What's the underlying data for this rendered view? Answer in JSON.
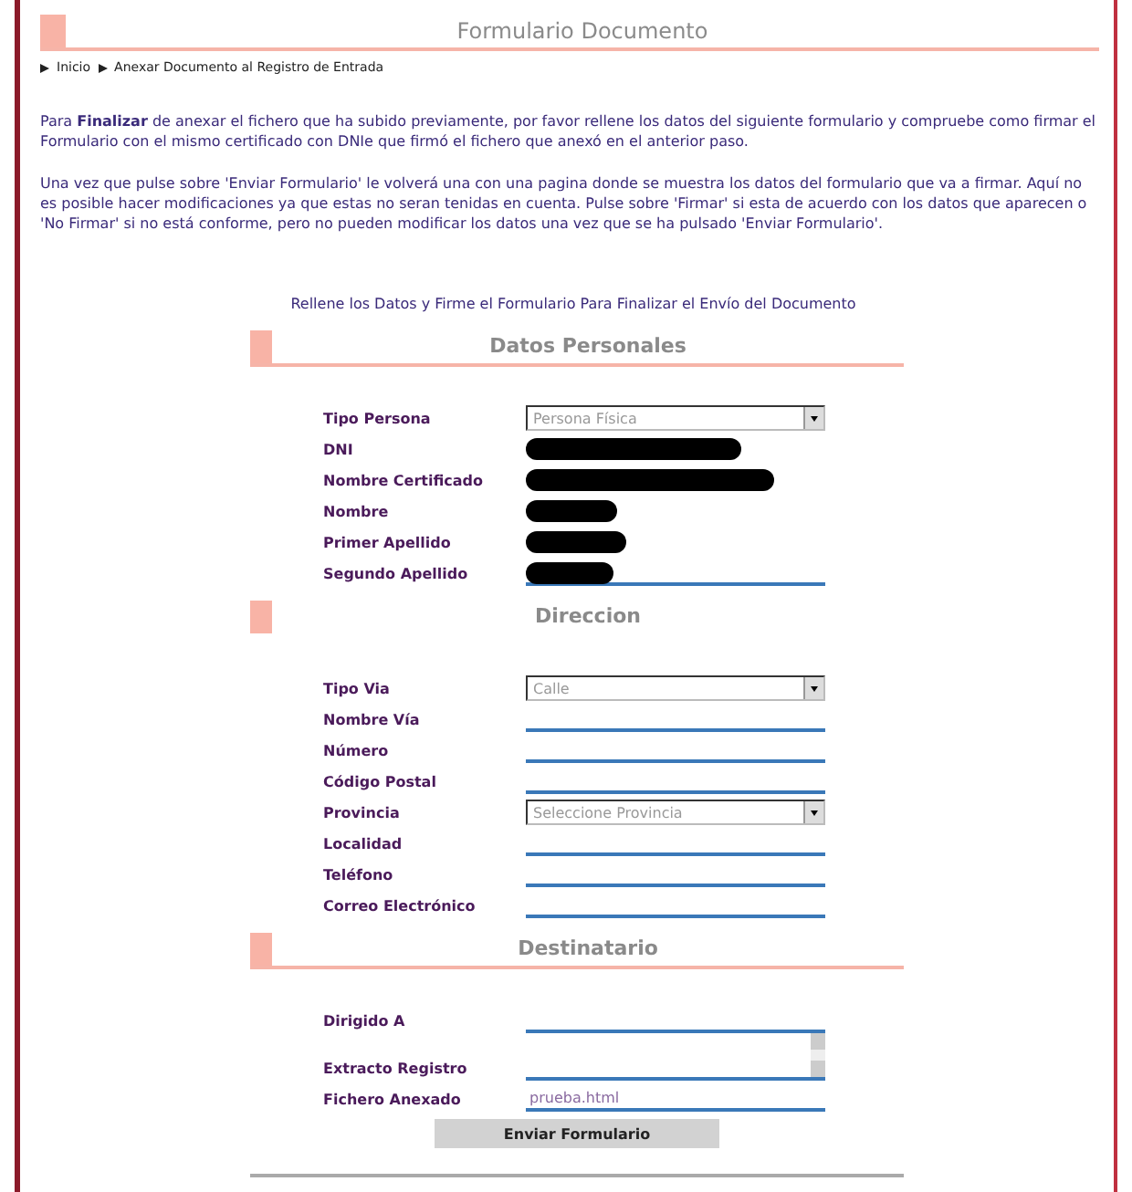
{
  "page": {
    "title": "Formulario Documento"
  },
  "breadcrumb": [
    "Inicio",
    "Anexar Documento al Registro de Entrada"
  ],
  "intro": [
    "Para **Finalizar** de anexar el fichero que ha subido previamente, por favor rellene los datos del siguiente formulario y compruebe como firmar el Formulario con el mismo certificado con DNIe que firmó el fichero que anexó en el anterior paso.",
    "Una vez que pulse sobre 'Enviar Formulario' le volverá una con una pagina donde se muestra los datos del formulario que va a firmar. Aquí no es posible hacer modificaciones ya que estas no seran tenidas en cuenta. Pulse sobre 'Firmar' si esta de acuerdo con los datos que aparecen o 'No Firmar' si no está conforme, pero no pueden modificar los datos una vez que se ha pulsado 'Enviar Formulario'."
  ],
  "instruction": "Rellene los Datos y Firme el Formulario Para Finalizar el Envío del Documento",
  "sections": [
    {
      "title": "Datos Personales",
      "underlined": true,
      "fields": [
        {
          "label": "Tipo Persona",
          "kind": "select",
          "value": "Persona Física"
        },
        {
          "label": "DNI",
          "kind": "redacted"
        },
        {
          "label": "Nombre Certificado",
          "kind": "redacted"
        },
        {
          "label": "Nombre",
          "kind": "redacted"
        },
        {
          "label": "Primer Apellido",
          "kind": "redacted"
        },
        {
          "label": "Segundo Apellido",
          "kind": "redacted"
        }
      ]
    },
    {
      "title": "Direccion",
      "underlined": false,
      "fields": [
        {
          "label": "Tipo Via",
          "kind": "select",
          "value": "Calle"
        },
        {
          "label": "Nombre Vía",
          "kind": "text"
        },
        {
          "label": "Número",
          "kind": "text"
        },
        {
          "label": "Código Postal",
          "kind": "text"
        },
        {
          "label": "Provincia",
          "kind": "select",
          "value": "Seleccione Provincia"
        },
        {
          "label": "Localidad",
          "kind": "text"
        },
        {
          "label": "Teléfono",
          "kind": "text"
        },
        {
          "label": "Correo Electrónico",
          "kind": "text"
        }
      ]
    },
    {
      "title": "Destinatario",
      "underlined": true,
      "fields": [
        {
          "label": "Dirigido A",
          "kind": "text"
        },
        {
          "label": "Extracto Registro",
          "kind": "textarea"
        },
        {
          "label": "Fichero Anexado",
          "kind": "text",
          "value": "prueba.html"
        }
      ]
    }
  ],
  "submit": "Enviar Formulario"
}
